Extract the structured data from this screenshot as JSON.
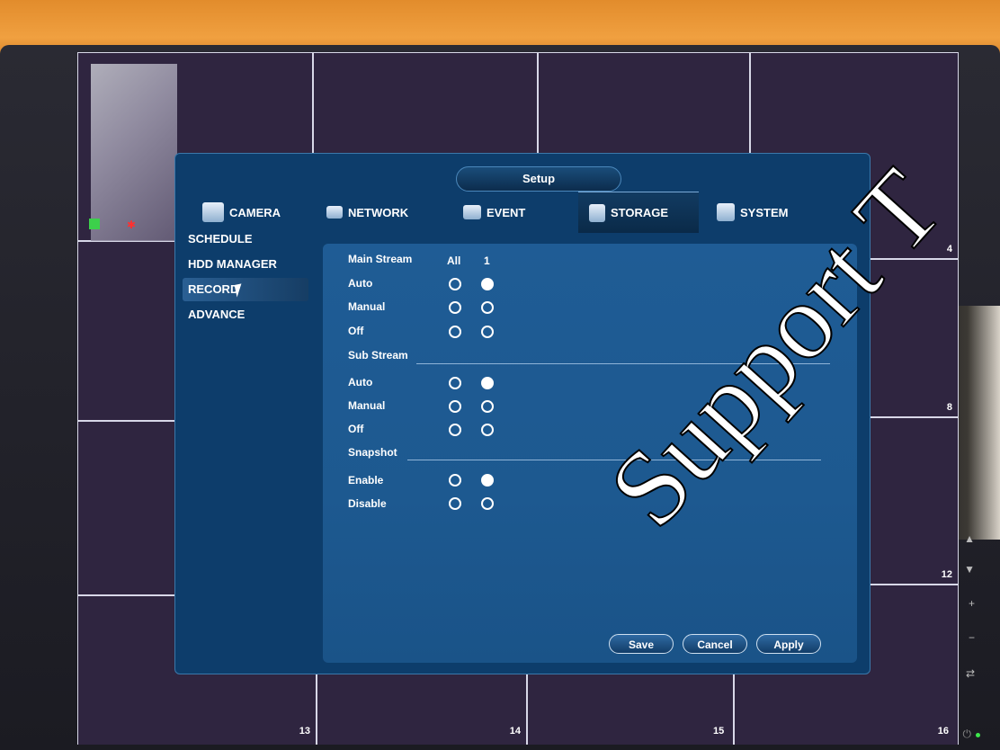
{
  "dialog": {
    "title": "Setup"
  },
  "tabs": [
    {
      "label": "CAMERA",
      "icon": "camera-icon",
      "active": false
    },
    {
      "label": "NETWORK",
      "icon": "network-icon",
      "active": false
    },
    {
      "label": "EVENT",
      "icon": "event-icon",
      "active": false
    },
    {
      "label": "STORAGE",
      "icon": "storage-icon",
      "active": true
    },
    {
      "label": "SYSTEM",
      "icon": "system-icon",
      "active": false
    }
  ],
  "menu": [
    {
      "label": "SCHEDULE",
      "selected": false
    },
    {
      "label": "HDD MANAGER",
      "selected": false
    },
    {
      "label": "RECORD",
      "selected": true
    },
    {
      "label": "ADVANCE",
      "selected": false
    }
  ],
  "record": {
    "main_stream": {
      "title": "Main Stream",
      "columns": [
        "All",
        "1"
      ],
      "rows": [
        {
          "label": "Auto",
          "all": false,
          "ch1": true
        },
        {
          "label": "Manual",
          "all": false,
          "ch1": false
        },
        {
          "label": "Off",
          "all": false,
          "ch1": false
        }
      ]
    },
    "sub_stream": {
      "title": "Sub Stream",
      "rows": [
        {
          "label": "Auto",
          "all": false,
          "ch1": true
        },
        {
          "label": "Manual",
          "all": false,
          "ch1": false
        },
        {
          "label": "Off",
          "all": false,
          "ch1": false
        }
      ]
    },
    "snapshot": {
      "title": "Snapshot",
      "rows": [
        {
          "label": "Enable",
          "all": false,
          "ch1": true
        },
        {
          "label": "Disable",
          "all": false,
          "ch1": false
        }
      ]
    }
  },
  "buttons": {
    "save": "Save",
    "cancel": "Cancel",
    "apply": "Apply"
  },
  "grid_numbers": {
    "c4": "4",
    "c8": "8",
    "c12": "12",
    "c13": "13",
    "c14": "14",
    "c15": "15",
    "c16": "16"
  },
  "watermark": "Support T",
  "colors": {
    "dialog_bg": "#0d3d6b",
    "panel_bg": "#1f5c95",
    "accent": "#4a87bb"
  }
}
